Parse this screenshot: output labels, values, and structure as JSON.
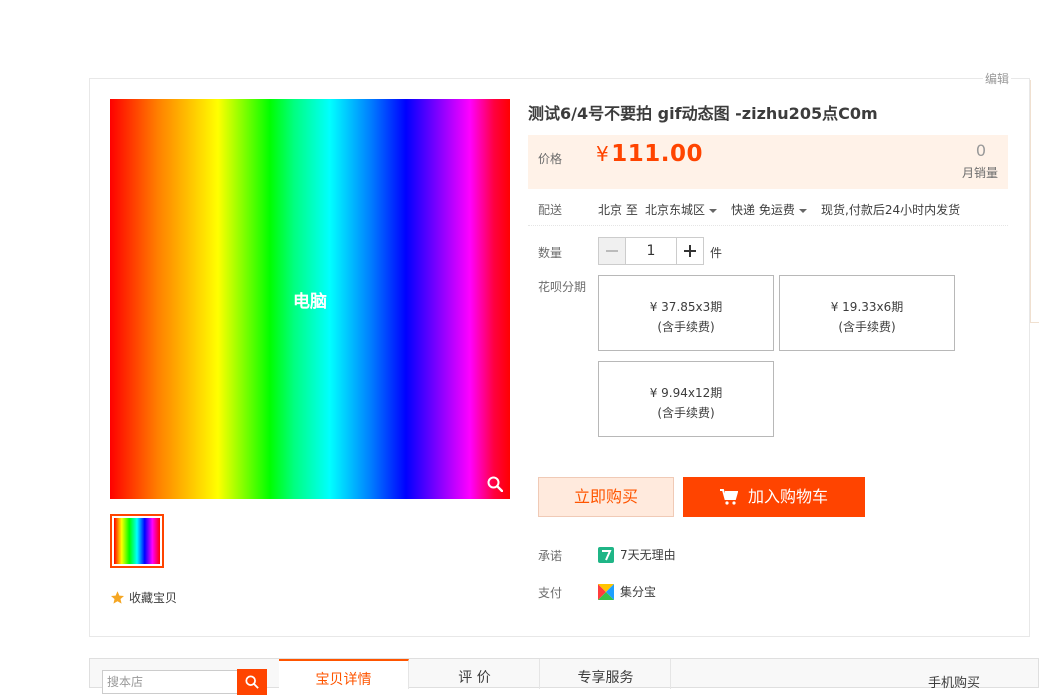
{
  "header": {
    "edit_label": "编辑"
  },
  "gallery": {
    "main_image_label": "电脑",
    "favorite_label": "收藏宝贝"
  },
  "product": {
    "title": "测试6/4号不要拍 gif动态图 -zizhu205点C0m",
    "price_label": "价格",
    "currency": "¥",
    "price": "111.00",
    "monthly_sales": "0",
    "monthly_sales_label": "月销量"
  },
  "shipping": {
    "label": "配送",
    "origin": "北京 至",
    "destination": "北京东城区",
    "method": "快递 免运费",
    "dispatch": "现货,付款后24小时内发货"
  },
  "quantity": {
    "label": "数量",
    "value": "1",
    "unit": "件"
  },
  "installments": {
    "label": "花呗分期",
    "options": [
      {
        "plan": "¥ 37.85x3期",
        "fee": "(含手续费)"
      },
      {
        "plan": "¥ 19.33x6期",
        "fee": "(含手续费)"
      },
      {
        "plan": "¥ 9.94x12期",
        "fee": "(含手续费)"
      }
    ]
  },
  "actions": {
    "buy_now": "立即购买",
    "add_to_cart": "加入购物车"
  },
  "promise": {
    "label": "承诺",
    "text": "7天无理由"
  },
  "payment": {
    "label": "支付",
    "text": "集分宝"
  },
  "bottom_nav": {
    "search_placeholder": "搜本店",
    "tabs": [
      "宝贝详情",
      "评  价",
      "专享服务"
    ],
    "mobile_buy": "手机购买"
  },
  "colors": {
    "accent": "#ff4400",
    "price_bg": "#fff2e8"
  }
}
